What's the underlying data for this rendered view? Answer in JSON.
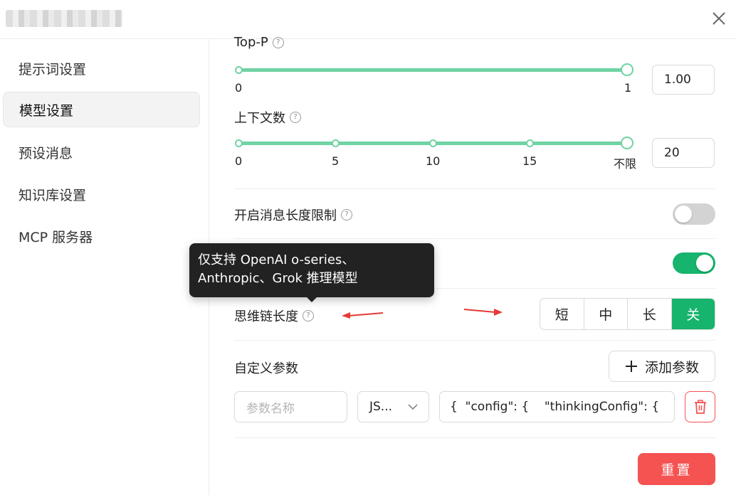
{
  "header": {
    "close_label": "×"
  },
  "sidebar": {
    "items": [
      {
        "label": "提示词设置"
      },
      {
        "label": "模型设置",
        "active": true
      },
      {
        "label": "预设消息"
      },
      {
        "label": "知识库设置"
      },
      {
        "label": "MCP 服务器"
      }
    ]
  },
  "top_p": {
    "label": "Top-P",
    "min_label": "0",
    "max_label": "1",
    "value": "1.00",
    "fraction": 1.0
  },
  "context": {
    "label": "上下文数",
    "ticks": [
      "0",
      "5",
      "10",
      "15",
      "不限"
    ],
    "value": "20",
    "fraction": 1.0
  },
  "length_limit": {
    "label": "开启消息长度限制",
    "enabled": false
  },
  "stream": {
    "enabled": true
  },
  "tooltip": {
    "text": "仅支持 OpenAI o-series、Anthropic、Grok 推理模型"
  },
  "reasoning": {
    "label": "思维链长度",
    "options": [
      "短",
      "中",
      "长",
      "关"
    ],
    "selected": "关"
  },
  "custom_params": {
    "label": "自定义参数",
    "add_button": "添加参数",
    "name_placeholder": "参数名称",
    "type_value": "JS...",
    "value_text": "{  \"config\": {    \"thinkingConfig\": {"
  },
  "reset_button": "重置",
  "colors": {
    "accent": "#16b46c",
    "slider": "#6fd3a3",
    "danger": "#f55252",
    "arrow": "#e53935"
  }
}
